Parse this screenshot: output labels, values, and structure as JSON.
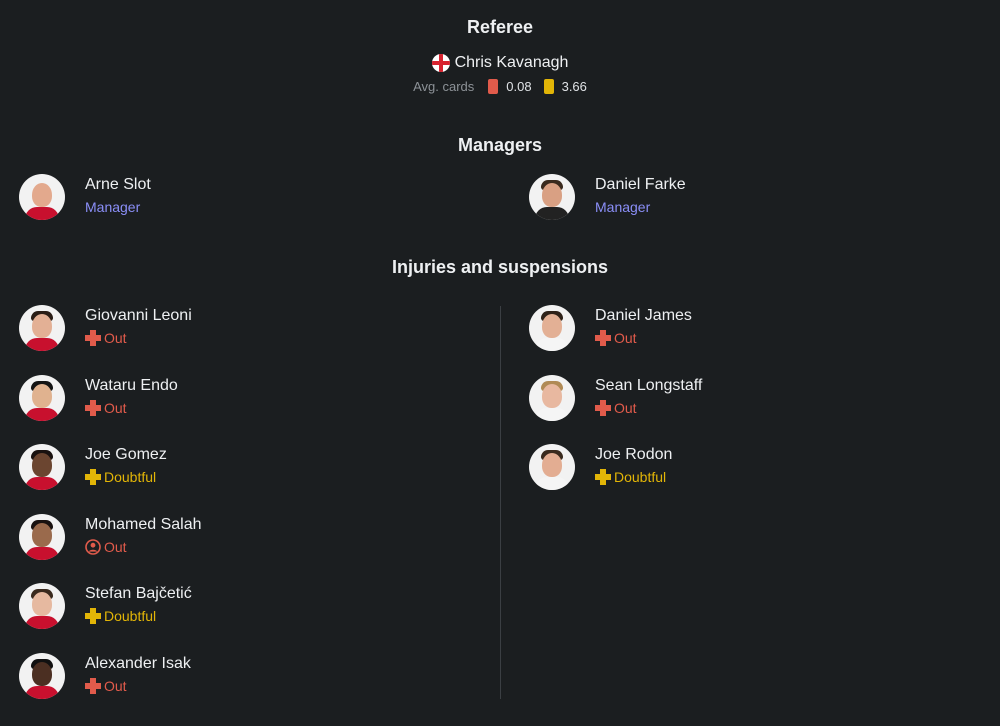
{
  "referee": {
    "heading": "Referee",
    "flag_icon": "england-flag-icon",
    "name": "Chris Kavanagh",
    "avg_cards_label": "Avg. cards",
    "red_avg": "0.08",
    "yellow_avg": "3.66"
  },
  "managers": {
    "heading": "Managers",
    "home": {
      "name": "Arne Slot",
      "role": "Manager"
    },
    "away": {
      "name": "Daniel Farke",
      "role": "Manager"
    }
  },
  "injuries": {
    "heading": "Injuries and suspensions",
    "home": [
      {
        "name": "Giovanni Leoni",
        "status": "Out",
        "type": "injury"
      },
      {
        "name": "Wataru Endo",
        "status": "Out",
        "type": "injury"
      },
      {
        "name": "Joe Gomez",
        "status": "Doubtful",
        "type": "injury"
      },
      {
        "name": "Mohamed Salah",
        "status": "Out",
        "type": "suspension"
      },
      {
        "name": "Stefan Bajčetić",
        "status": "Doubtful",
        "type": "injury"
      },
      {
        "name": "Alexander Isak",
        "status": "Out",
        "type": "injury"
      }
    ],
    "away": [
      {
        "name": "Daniel James",
        "status": "Out",
        "type": "injury"
      },
      {
        "name": "Sean Longstaff",
        "status": "Out",
        "type": "injury"
      },
      {
        "name": "Joe Rodon",
        "status": "Doubtful",
        "type": "injury"
      }
    ]
  },
  "colors": {
    "background": "#1b1e20",
    "out": "#e15b4b",
    "doubtful": "#e2b507",
    "role": "#8b8ff8",
    "red_card": "#e15b4b",
    "yellow_card": "#e2b507"
  }
}
